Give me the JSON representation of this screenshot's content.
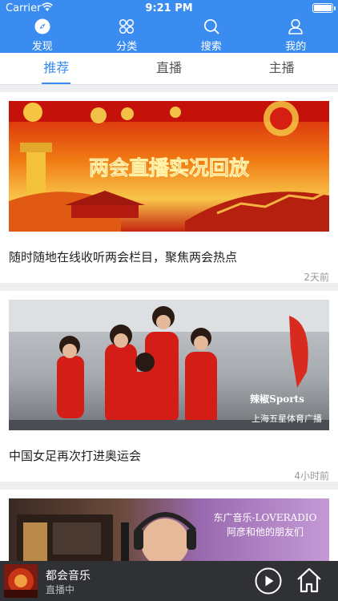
{
  "status_bar": {
    "carrier": "Carrier",
    "time": "9:21 PM"
  },
  "nav": {
    "items": [
      {
        "label": "发现",
        "icon": "compass-icon"
      },
      {
        "label": "分类",
        "icon": "grid-icon"
      },
      {
        "label": "搜索",
        "icon": "search-icon"
      },
      {
        "label": "我的",
        "icon": "user-icon"
      }
    ]
  },
  "tabs": [
    {
      "label": "推荐",
      "active": true
    },
    {
      "label": "直播",
      "active": false
    },
    {
      "label": "主播",
      "active": false
    }
  ],
  "feed": [
    {
      "image_text": "两会直播实况回放",
      "title": "随时随地在线收听两会栏目，聚焦两会热点",
      "time": "2天前"
    },
    {
      "image_texts": [
        "辣椒Sports",
        "上海五星体育广播"
      ],
      "title": "中国女足再次打进奥运会",
      "time": "4小时前"
    },
    {
      "image_texts": [
        "东广音乐-LOVERADIO",
        "阿彦和他的朋友们"
      ]
    }
  ],
  "player": {
    "name": "都会音乐",
    "state": "直播中"
  },
  "colors": {
    "accent": "#3b8cf0",
    "player_bg": "#2f3134"
  }
}
